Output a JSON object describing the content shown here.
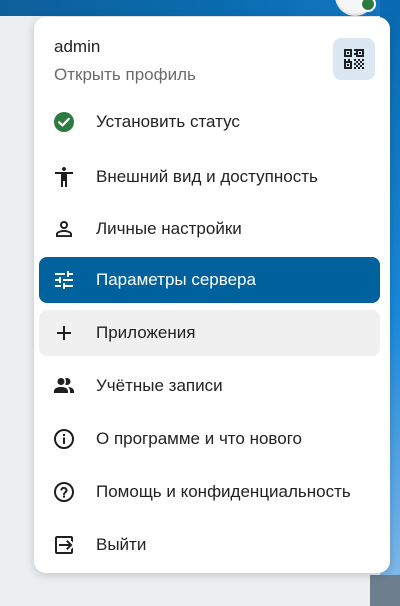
{
  "profile": {
    "username": "admin",
    "open_profile_label": "Открыть профиль",
    "qr_icon": "qr-code-icon"
  },
  "menu": {
    "items": [
      {
        "label": "Установить статус",
        "icon": "status-check-icon"
      },
      {
        "label": "Внешний вид и доступность",
        "icon": "accessibility-icon"
      },
      {
        "label": "Личные настройки",
        "icon": "account-icon"
      },
      {
        "label": "Параметры сервера",
        "icon": "tune-icon",
        "state": "active"
      },
      {
        "label": "Приложения",
        "icon": "plus-icon",
        "state": "hover"
      },
      {
        "label": "Учётные записи",
        "icon": "account-group-icon"
      },
      {
        "label": "О программе и что нового",
        "icon": "info-icon"
      },
      {
        "label": "Помощь и конфиденциальность",
        "icon": "help-icon"
      },
      {
        "label": "Выйти",
        "icon": "logout-icon"
      }
    ]
  },
  "colors": {
    "accent": "#00629d",
    "status_online": "#2d7b41",
    "hover_background": "#f0f0f0",
    "qr_button_background": "#dbe7f2"
  }
}
